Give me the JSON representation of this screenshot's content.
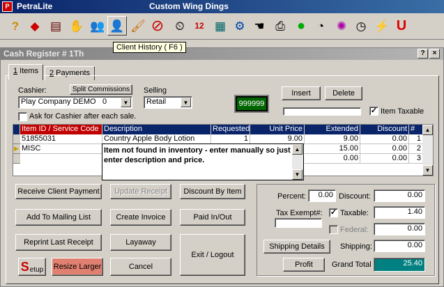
{
  "app": {
    "name": "PetraLite",
    "title": "Custom Wing Dings"
  },
  "toolbar": {
    "icons": [
      "help-icon",
      "shapes-icon",
      "ledger-icon",
      "hand-stop-icon",
      "people-icon",
      "client-history-icon",
      "brush-icon",
      "no-entry-icon",
      "timer-icon",
      "calendar-icon",
      "calculator-icon",
      "tools-icon",
      "hand-open-icon",
      "printer-icon",
      "green-circle-icon",
      "speedometer-icon",
      "color-wheel-icon",
      "clock-icon",
      "lightning-icon",
      "magnet-icon"
    ],
    "tooltip": "Client History ( F6 )"
  },
  "window": {
    "title": "Cash Register # 1Th",
    "help": "?",
    "close": "×"
  },
  "tabs": [
    {
      "label": "1 Items",
      "hotkey": "1",
      "rest": " Items"
    },
    {
      "label": "2 Payments",
      "hotkey": "2",
      "rest": " Payments"
    }
  ],
  "cashier": {
    "label": "Cashier:",
    "split_commissions": "Split Commissions",
    "name": "Play Company DEMO",
    "number": "0",
    "ask_label": "Ask for Cashier after each sale."
  },
  "selling": {
    "label": "Selling",
    "value": "Retail"
  },
  "lcd_code": "999999",
  "insert_label": "Insert",
  "delete_label": "Delete",
  "item_taxable_label": "Item Taxable",
  "grid": {
    "headers": [
      "Item ID / Service Code",
      "Description",
      "Requested",
      "Unit Price",
      "Extended",
      "Discount",
      "#"
    ],
    "rows": [
      {
        "id": "51855031",
        "desc": "Country Apple Body Lotion",
        "req": "1",
        "price": "9.00",
        "ext": "9.00",
        "disc": "0.00",
        "num": "1"
      },
      {
        "id": "MISC",
        "desc": "",
        "req": "",
        "price": "",
        "ext": "15.00",
        "disc": "0.00",
        "num": "2"
      },
      {
        "id": "",
        "desc": "",
        "req": "",
        "price": "",
        "ext": "0.00",
        "disc": "0.00",
        "num": "3"
      }
    ]
  },
  "popup_text": "Item not found in inventory - enter manually so just enter description and price.",
  "buttons": {
    "receive_payment": "Receive Client Payment",
    "update_receipt": "Update Receipt",
    "discount_by_item": "Discount By Item",
    "add_mailing": "Add To Mailing List",
    "create_invoice": "Create Invoice",
    "paid_in_out": "Paid In/Out",
    "reprint": "Reprint Last Receipt",
    "layaway": "Layaway",
    "exit_logout": "Exit / Logout",
    "setup": "etup",
    "resize_larger": "Resize Larger",
    "cancel": "Cancel",
    "shipping_details": "Shipping Details",
    "profit": "Profit"
  },
  "totals": {
    "percent_label": "Percent:",
    "percent": "0.00",
    "discount_label": "Discount:",
    "discount": "0.00",
    "tax_exempt_label": "Tax Exempt#:",
    "taxable_label": "Taxable:",
    "taxable": "1.40",
    "federal_label": "Federal:",
    "federal": "0.00",
    "shipping_label": "Shipping:",
    "shipping": "0.00",
    "grand_total_label": "Grand Total",
    "grand_total": "25.40"
  }
}
